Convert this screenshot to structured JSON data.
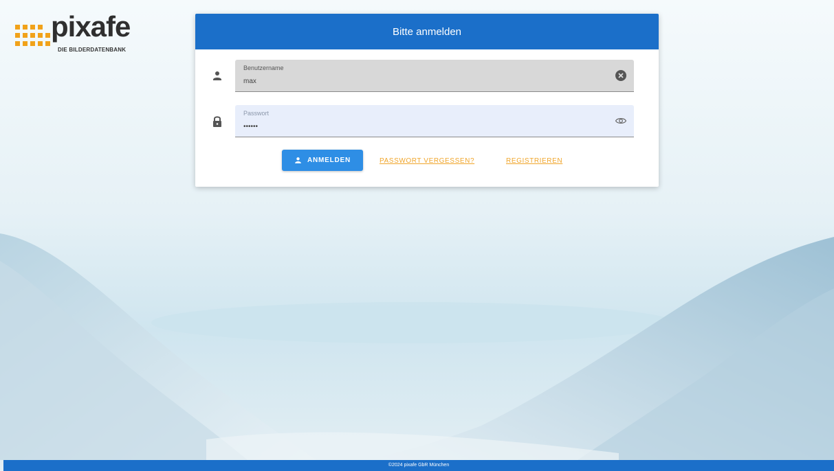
{
  "brand": {
    "name": "pixafe",
    "tagline": "DIE BILDERDATENBANK",
    "accent_color": "#f1a21a"
  },
  "login": {
    "title": "Bitte anmelden",
    "header_color": "#1b6fc9",
    "username": {
      "label": "Benutzername",
      "value": "max",
      "prefix_icon": "user-icon",
      "suffix_icon": "clear-icon"
    },
    "password": {
      "label": "Passwort",
      "value": "••••••",
      "prefix_icon": "lock-icon",
      "suffix_icon": "eye-icon"
    },
    "submit_label": "ANMELDEN",
    "forgot_label": "PASSWORT VERGESSEN?",
    "register_label": "REGISTRIEREN"
  },
  "footer": {
    "text": "©2024 pixafe GbR München"
  }
}
